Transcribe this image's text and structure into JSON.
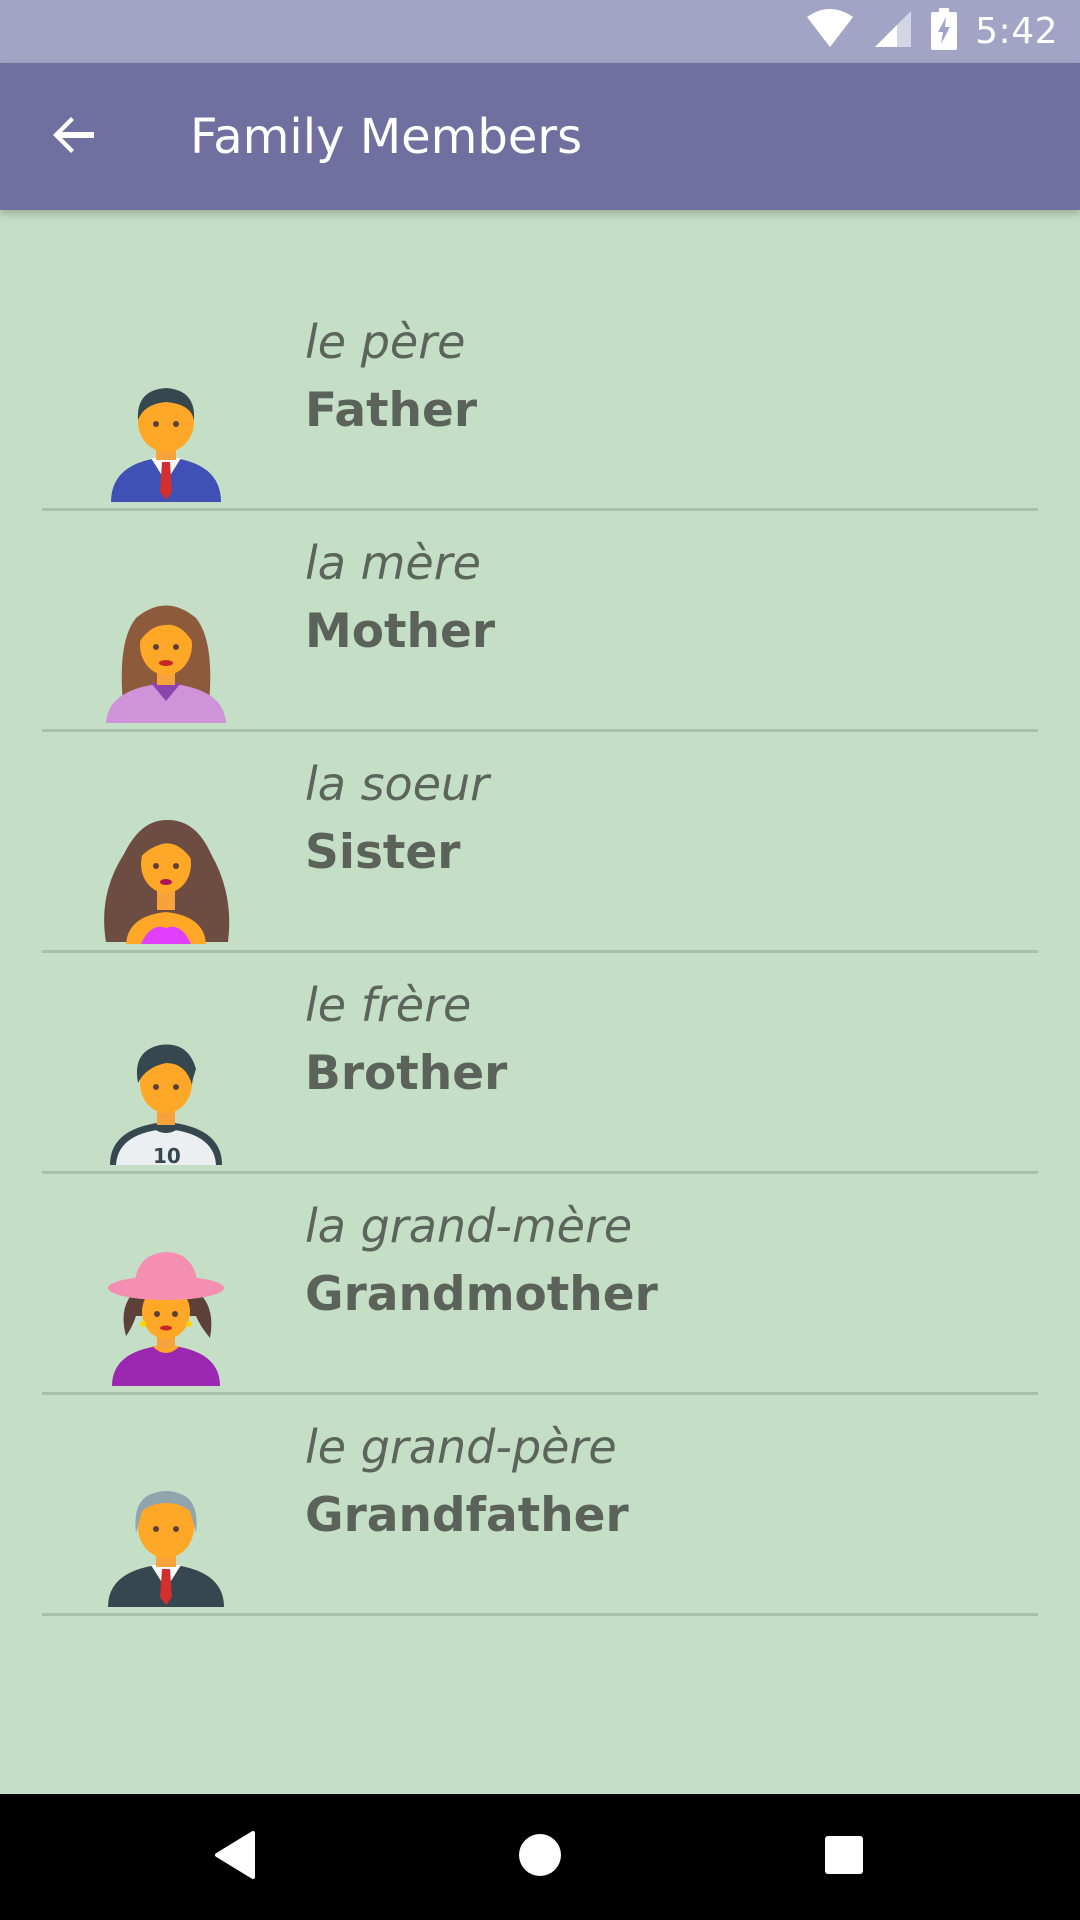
{
  "status_bar": {
    "time": "5:42",
    "icons": [
      "wifi-icon",
      "cell-signal-icon",
      "battery-charging-icon"
    ]
  },
  "app_bar": {
    "title": "Family Members",
    "back_icon": "arrow-back-icon"
  },
  "colors": {
    "status_bar": "#a2a4c5",
    "app_bar": "#6f70a0",
    "background": "#c5dfc6",
    "divider": "#a8c2aa",
    "text": "#5a625a"
  },
  "items": [
    {
      "french": "le père",
      "english": "Father",
      "icon": "father-avatar-icon"
    },
    {
      "french": "la mère",
      "english": "Mother",
      "icon": "mother-avatar-icon"
    },
    {
      "french": "la soeur",
      "english": "Sister",
      "icon": "sister-avatar-icon"
    },
    {
      "french": "le frère",
      "english": "Brother",
      "icon": "brother-avatar-icon"
    },
    {
      "french": "la grand-mère",
      "english": "Grandmother",
      "icon": "grandmother-avatar-icon"
    },
    {
      "french": "le grand-père",
      "english": "Grandfather",
      "icon": "grandfather-avatar-icon"
    }
  ],
  "nav_bar": {
    "buttons": [
      "back-triangle-icon",
      "home-circle-icon",
      "recents-square-icon"
    ]
  }
}
